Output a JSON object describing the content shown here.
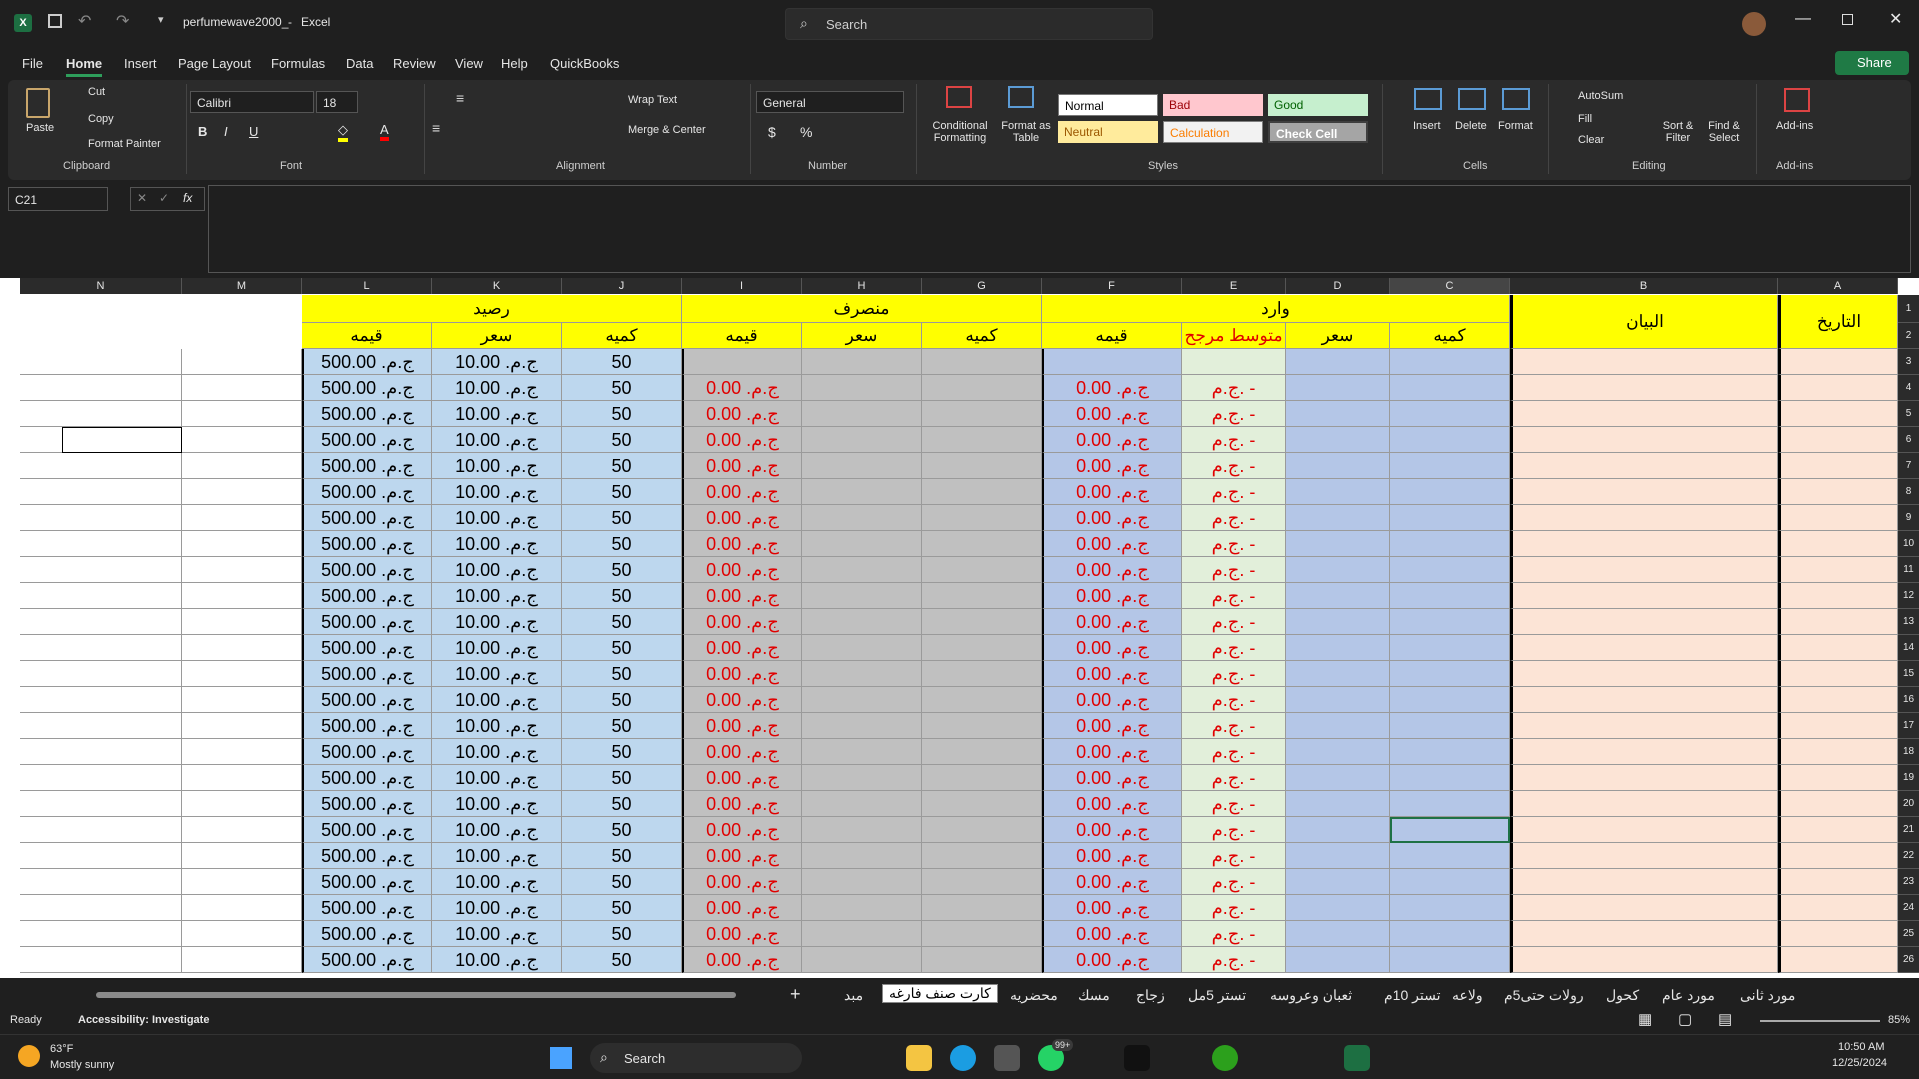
{
  "title_bar": {
    "filename": "perfumewave2000_",
    "app": "Excel",
    "search_placeholder": "Search"
  },
  "menu": [
    "File",
    "Home",
    "Insert",
    "Page Layout",
    "Formulas",
    "Data",
    "Review",
    "View",
    "Help",
    "QuickBooks"
  ],
  "share_label": "Share",
  "ribbon": {
    "clipboard": {
      "paste": "Paste",
      "cut": "Cut",
      "copy": "Copy",
      "format_painter": "Format Painter",
      "group": "Clipboard"
    },
    "font": {
      "name": "Calibri",
      "size": "18",
      "group": "Font"
    },
    "alignment": {
      "wrap": "Wrap Text",
      "merge": "Merge & Center",
      "group": "Alignment"
    },
    "number": {
      "format": "General",
      "group": "Number"
    },
    "styles": {
      "conditional": "Conditional Formatting",
      "format_table": "Format as Table",
      "normal": "Normal",
      "bad": "Bad",
      "good": "Good",
      "neutral": "Neutral",
      "calculation": "Calculation",
      "check_cell": "Check Cell",
      "group": "Styles"
    },
    "cells": {
      "insert": "Insert",
      "delete": "Delete",
      "format": "Format",
      "group": "Cells"
    },
    "editing": {
      "autosum": "AutoSum",
      "fill": "Fill",
      "clear": "Clear",
      "sort": "Sort & Filter",
      "find": "Find & Select",
      "group": "Editing"
    },
    "addins": {
      "label": "Add-ins",
      "group": "Add-ins"
    }
  },
  "name_box": "C21",
  "columns": [
    "N",
    "M",
    "L",
    "K",
    "J",
    "I",
    "H",
    "G",
    "F",
    "E",
    "D",
    "C",
    "B",
    "A"
  ],
  "headers": {
    "balance": "رصيد",
    "outgoing": "منصرف",
    "incoming": "وارد",
    "statement": "البيان",
    "date": "التاريخ",
    "value": "قيمه",
    "price": "سعر",
    "qty": "كميه",
    "avg": "متوسط مرجح"
  },
  "values": {
    "balance_value": "ج.م. 500.00",
    "balance_price": "ج.م. 10.00",
    "balance_qty": "50",
    "out_value": "ج.م. 0.00",
    "in_value": "ج.م. 0.00",
    "avg": "ج.م.    -"
  },
  "rows": [
    3,
    4,
    5,
    6,
    7,
    8,
    9,
    10,
    11,
    12,
    13,
    14,
    15,
    16,
    17,
    18,
    19,
    20,
    21,
    22,
    23,
    24,
    25,
    26
  ],
  "sheet_tabs": [
    "مورد ثانى",
    "مورد عام",
    "كحول",
    "رولات حتى5م",
    "ولاعه",
    "تستر 10م",
    "ثعبان وعروسه",
    "تستر 5مل",
    "زجاج",
    "مسك",
    "محضريه",
    "كارت صنف فارغه",
    "مبد"
  ],
  "status": {
    "ready": "Ready",
    "accessibility": "Accessibility: Investigate",
    "zoom": "85%"
  },
  "taskbar": {
    "temp": "63°F",
    "weather": "Mostly sunny",
    "search": "Search",
    "time": "10:50 AM",
    "date": "12/25/2024",
    "badge": "99+"
  }
}
